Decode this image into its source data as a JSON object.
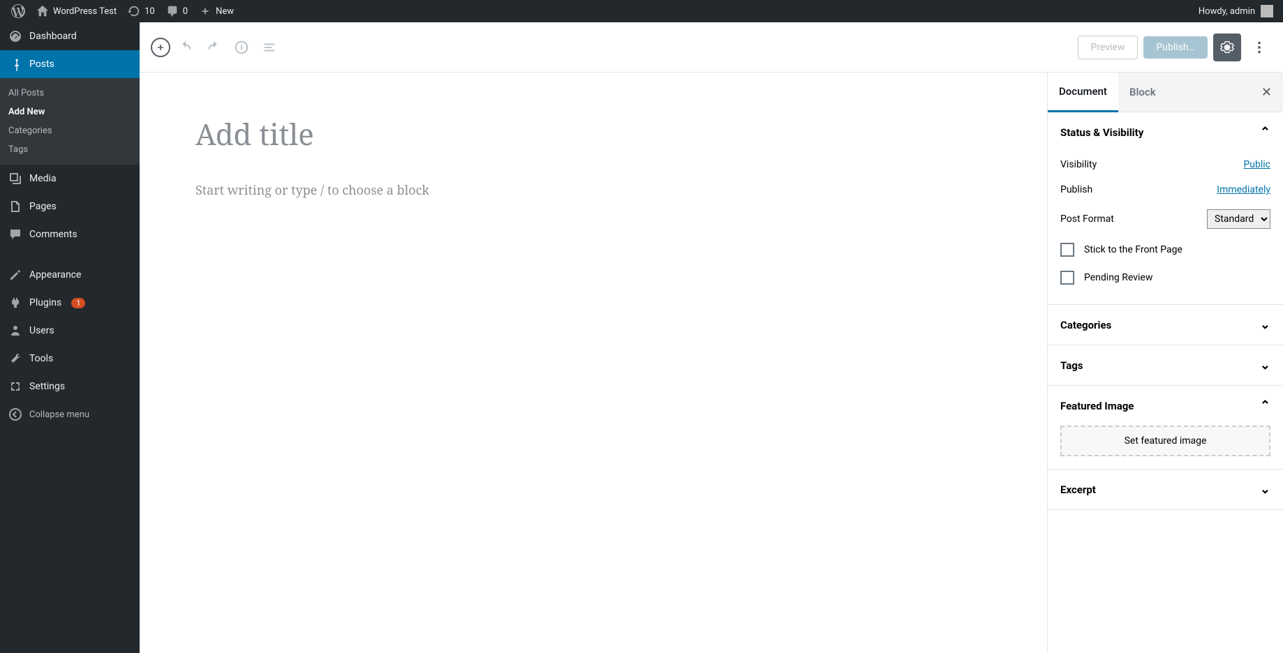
{
  "adminbar": {
    "site_name": "WordPress Test",
    "updates_count": "10",
    "comments_count": "0",
    "new_label": "New",
    "howdy": "Howdy, admin"
  },
  "sidebar": {
    "dashboard": "Dashboard",
    "posts": "Posts",
    "posts_sub": {
      "all": "All Posts",
      "add_new": "Add New",
      "categories": "Categories",
      "tags": "Tags"
    },
    "media": "Media",
    "pages": "Pages",
    "comments": "Comments",
    "appearance": "Appearance",
    "plugins": "Plugins",
    "plugins_badge": "1",
    "users": "Users",
    "tools": "Tools",
    "settings": "Settings",
    "collapse": "Collapse menu"
  },
  "editor": {
    "title_placeholder": "Add title",
    "body_placeholder": "Start writing or type / to choose a block",
    "preview": "Preview",
    "publish": "Publish…"
  },
  "settings_panel": {
    "tabs": {
      "document": "Document",
      "block": "Block"
    },
    "status": {
      "title": "Status & Visibility",
      "visibility_label": "Visibility",
      "visibility_value": "Public",
      "publish_label": "Publish",
      "publish_value": "Immediately",
      "format_label": "Post Format",
      "format_value": "Standard",
      "stick": "Stick to the Front Page",
      "pending": "Pending Review"
    },
    "categories": "Categories",
    "tags": "Tags",
    "featured": {
      "title": "Featured Image",
      "button": "Set featured image"
    },
    "excerpt": "Excerpt"
  }
}
